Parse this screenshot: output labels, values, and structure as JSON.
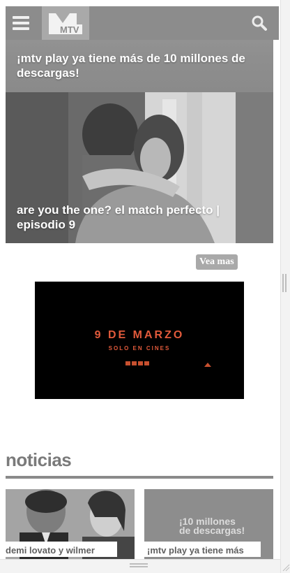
{
  "header": {
    "menu_icon": "hamburger-menu-icon",
    "logo_text": "MTV",
    "search_icon": "search-icon",
    "ghost_text": "10 millones\nde descargas!"
  },
  "stories": [
    {
      "title": "¡mtv play ya tiene más de 10 millones de descargas!"
    },
    {
      "title": "are you the one? el match perfecto | episodio 9"
    }
  ],
  "vea_mas_label": "Vea mas",
  "ad": {
    "date": "9 DE MARZO",
    "subtitle": "SOLO EN CINES"
  },
  "noticias": {
    "title": "noticias",
    "cards": [
      {
        "label": "demi lovato y wilmer"
      },
      {
        "label": "¡mtv play ya tiene más",
        "image_text": "¡10 millones\nde descargas!"
      }
    ]
  },
  "colors": {
    "header_bg": "#8c8c8c",
    "logo_bg": "#a9a9a9",
    "ad_bg": "#000000",
    "ad_accent": "#e15a3b",
    "section_text": "#7a7a7a"
  }
}
